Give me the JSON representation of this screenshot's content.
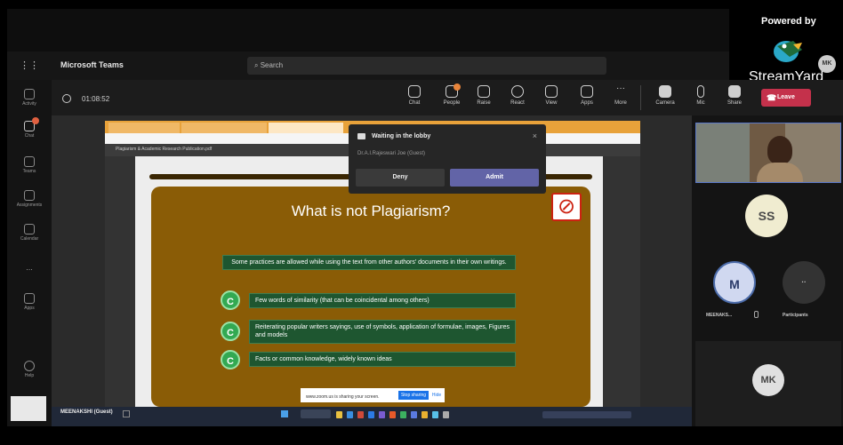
{
  "window": {
    "app_title": "Microsoft Teams",
    "search_placeholder": "Search"
  },
  "sidebar": {
    "items": [
      {
        "label": "Activity",
        "icon": "bell-icon"
      },
      {
        "label": "Chat",
        "icon": "chat-icon"
      },
      {
        "label": "Teams",
        "icon": "teams-icon"
      },
      {
        "label": "Assignments",
        "icon": "assignments-icon"
      },
      {
        "label": "Calendar",
        "icon": "calendar-icon"
      },
      {
        "label": "...",
        "icon": "more-icon"
      },
      {
        "label": "Apps",
        "icon": "apps-icon"
      },
      {
        "label": "Help",
        "icon": "help-icon"
      }
    ]
  },
  "meeting": {
    "timer": "01:08:52",
    "toolbar": [
      {
        "label": "Chat",
        "icon": "chat-icon"
      },
      {
        "label": "People",
        "icon": "people-icon"
      },
      {
        "label": "Raise",
        "icon": "hand-icon"
      },
      {
        "label": "React",
        "icon": "smile-icon"
      },
      {
        "label": "View",
        "icon": "view-icon"
      },
      {
        "label": "Apps",
        "icon": "apps-icon"
      },
      {
        "label": "More",
        "icon": "more-icon"
      },
      {
        "label": "Camera",
        "icon": "camera-icon"
      },
      {
        "label": "Mic",
        "icon": "mic-icon"
      },
      {
        "label": "Share",
        "icon": "share-icon"
      }
    ],
    "leave_label": "Leave",
    "leave_color": "#c4314b"
  },
  "streamyard": {
    "powered_by": "Powered by",
    "brand": "StreamYard"
  },
  "lobby": {
    "title": "Waiting in the lobby",
    "person": "Dr.A.I.Rajeswari Joe (Guest)",
    "deny_label": "Deny",
    "admit_label": "Admit",
    "admit_color": "#6264a7"
  },
  "shared_screen": {
    "pdf_title": "Plagiarism & Academic Research Publication.pdf",
    "slide": {
      "title": "What is not Plagiarism?",
      "intro": "Some practices are allowed while using the text from other authors' documents in their own writings.",
      "bullets": [
        "Few words of similarity (that can be coincidental among others)",
        "Reiterating popular writers sayings, use of symbols, application of formulae, images, Figures and models",
        "Facts or common knowledge, widely known ideas"
      ],
      "bullet_mark": "C"
    },
    "notice_text": "www.zoom.us is sharing your screen.",
    "notice_button": "Stop sharing",
    "notice_hide": "Hide"
  },
  "participants": {
    "ss": "SS",
    "m": "M",
    "m_name": "MEENAKS...",
    "participants_label": "Participants",
    "participants_icon": "ellipsis-icon",
    "mk": "MK"
  },
  "self_view": {
    "name": "MEENAKSHI (Guest)"
  },
  "colors": {
    "slide_bg": "#8a5c06",
    "box_bg": "#1e5630",
    "bullet": "#33a952"
  }
}
